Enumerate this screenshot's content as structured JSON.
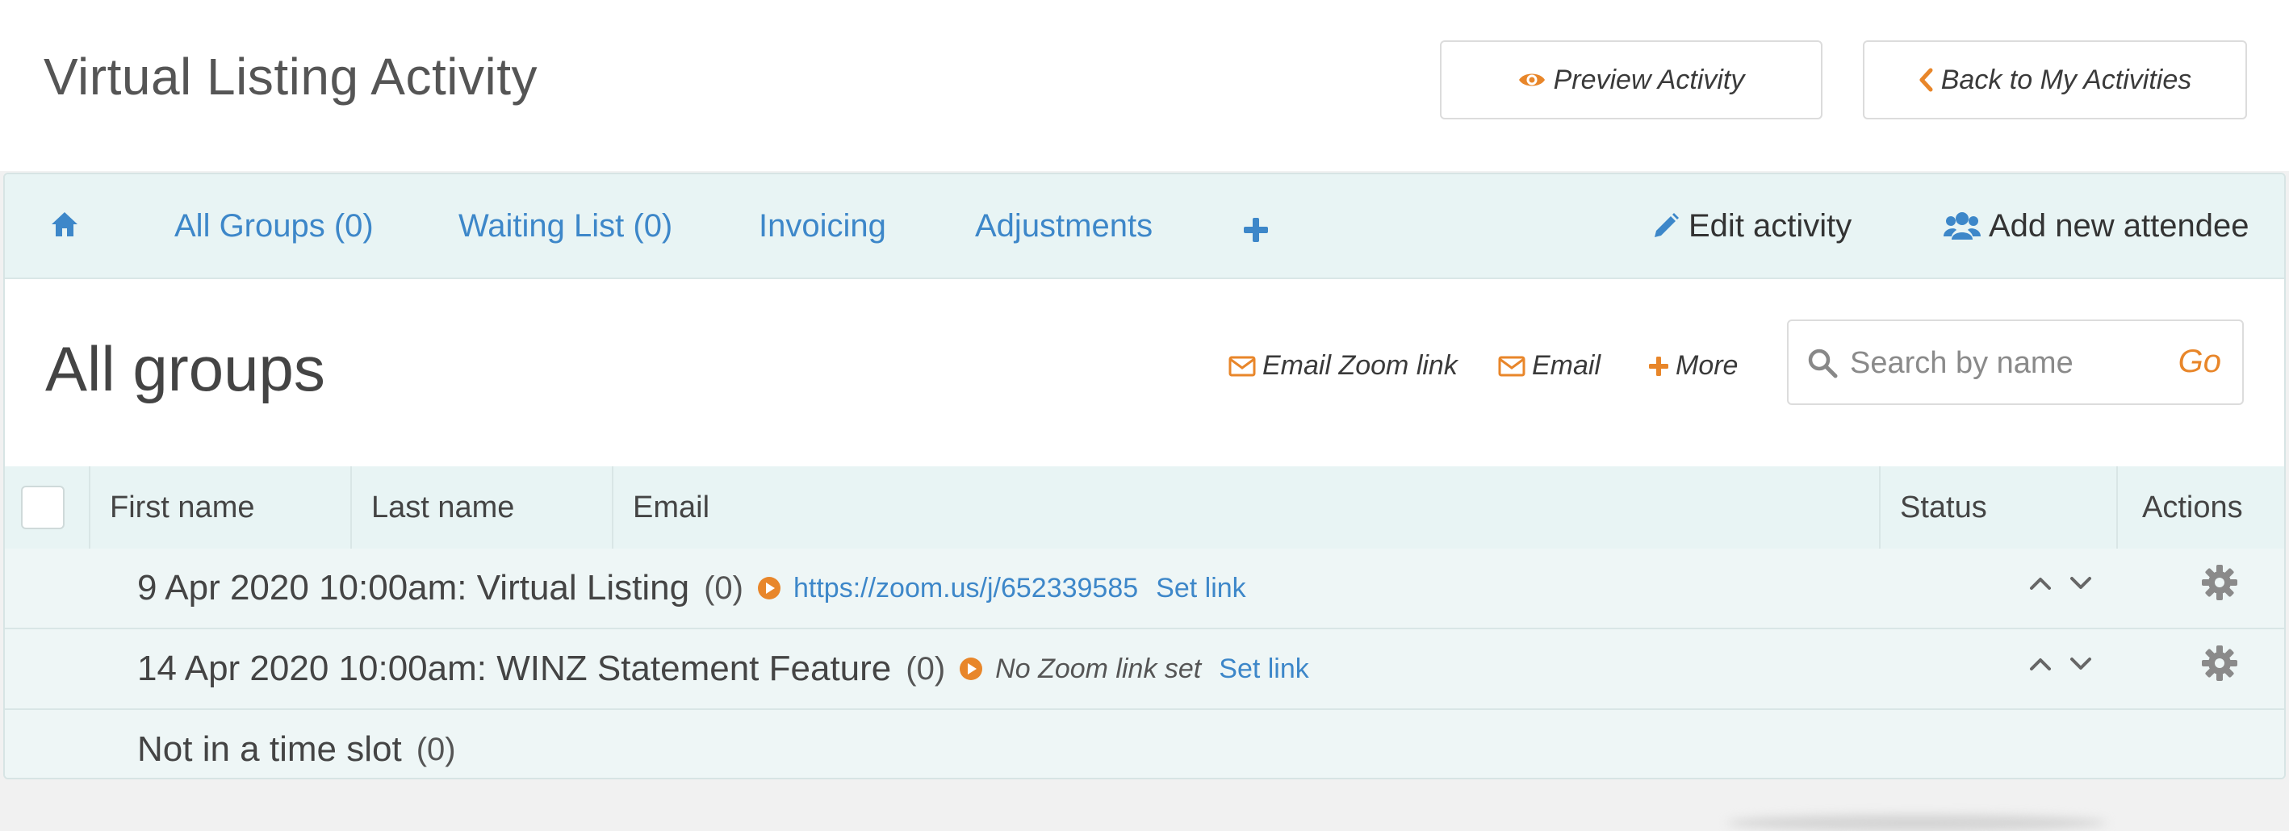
{
  "header": {
    "title": "Virtual Listing Activity",
    "preview_label": "Preview Activity",
    "back_label": "Back to My Activities"
  },
  "nav": {
    "home_icon": "home-icon",
    "tabs": [
      {
        "label": "All Groups (0)"
      },
      {
        "label": "Waiting List (0)"
      },
      {
        "label": "Invoicing"
      },
      {
        "label": "Adjustments"
      }
    ],
    "add_icon": "plus-icon",
    "edit_label": "Edit activity",
    "add_attendee_label": "Add new attendee"
  },
  "section": {
    "title": "All groups",
    "email_zoom_label": "Email Zoom link",
    "email_label": "Email",
    "more_label": "More",
    "search_placeholder": "Search by name",
    "go_label": "Go"
  },
  "table": {
    "columns": [
      "First name",
      "Last name",
      "Email",
      "Status",
      "Actions"
    ],
    "groups": [
      {
        "title": "9 Apr 2020 10:00am: Virtual Listing",
        "count": "(0)",
        "zoom_link": "https://zoom.us/j/652339585",
        "set_link": "Set link"
      },
      {
        "title": "14 Apr 2020 10:00am: WINZ Statement Feature",
        "count": "(0)",
        "zoom_none": "No Zoom link set",
        "set_link": "Set link"
      },
      {
        "title": "Not in a time slot",
        "count": "(0)"
      }
    ]
  },
  "colors": {
    "accent_orange": "#e8862a",
    "link_blue": "#3d87c9",
    "panel_bg": "#eef6f6"
  }
}
